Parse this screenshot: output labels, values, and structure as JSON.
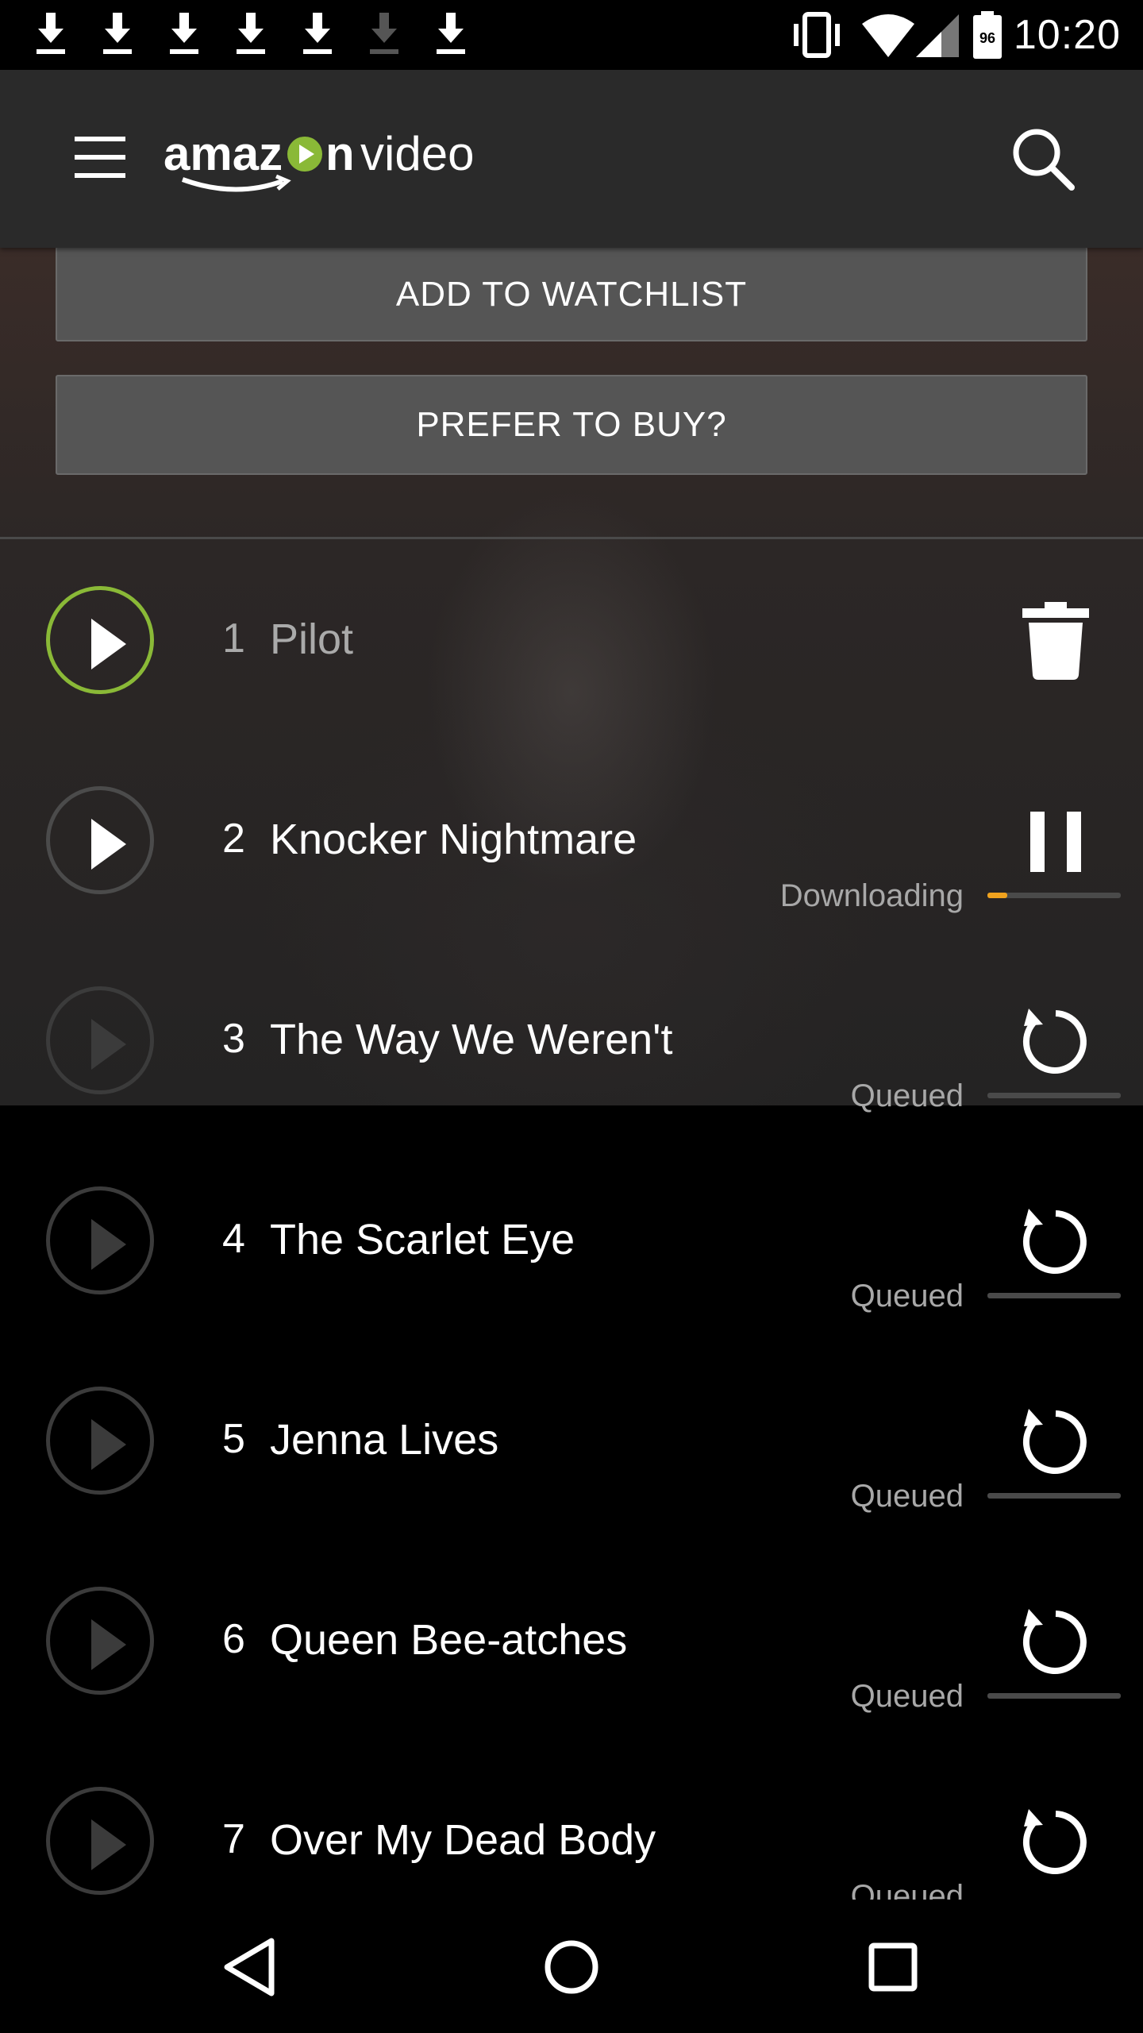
{
  "status_bar": {
    "time": "10:20",
    "battery": "96",
    "notification_icons": [
      "download-icon",
      "download-icon",
      "download-icon",
      "download-icon",
      "download-icon",
      "download-icon",
      "download-icon"
    ]
  },
  "app_bar": {
    "logo_text_left": "amaz",
    "logo_text_right": "n",
    "logo_text_video": "video"
  },
  "actions": {
    "watchlist_label": "ADD TO WATCHLIST",
    "buy_label": "PREFER TO BUY?"
  },
  "episodes": [
    {
      "number": "1",
      "title": "Pilot",
      "status": "",
      "action": "delete-icon",
      "progress": null
    },
    {
      "number": "2",
      "title": "Knocker Nightmare",
      "status": "Downloading",
      "action": "pause-icon",
      "progress": 0.15
    },
    {
      "number": "3",
      "title": "The Way We Weren't",
      "status": "Queued",
      "action": "retry-icon",
      "progress": 0
    },
    {
      "number": "4",
      "title": "The Scarlet Eye",
      "status": "Queued",
      "action": "retry-icon",
      "progress": 0
    },
    {
      "number": "5",
      "title": "Jenna Lives",
      "status": "Queued",
      "action": "retry-icon",
      "progress": 0
    },
    {
      "number": "6",
      "title": "Queen Bee-atches",
      "status": "Queued",
      "action": "retry-icon",
      "progress": 0
    },
    {
      "number": "7",
      "title": "Over My Dead Body",
      "status": "Queued",
      "action": "retry-icon",
      "progress": 0
    }
  ],
  "colors": {
    "accent_green": "#8ab937",
    "progress_orange": "#f0a21e",
    "app_bar": "#2a2a2a"
  }
}
